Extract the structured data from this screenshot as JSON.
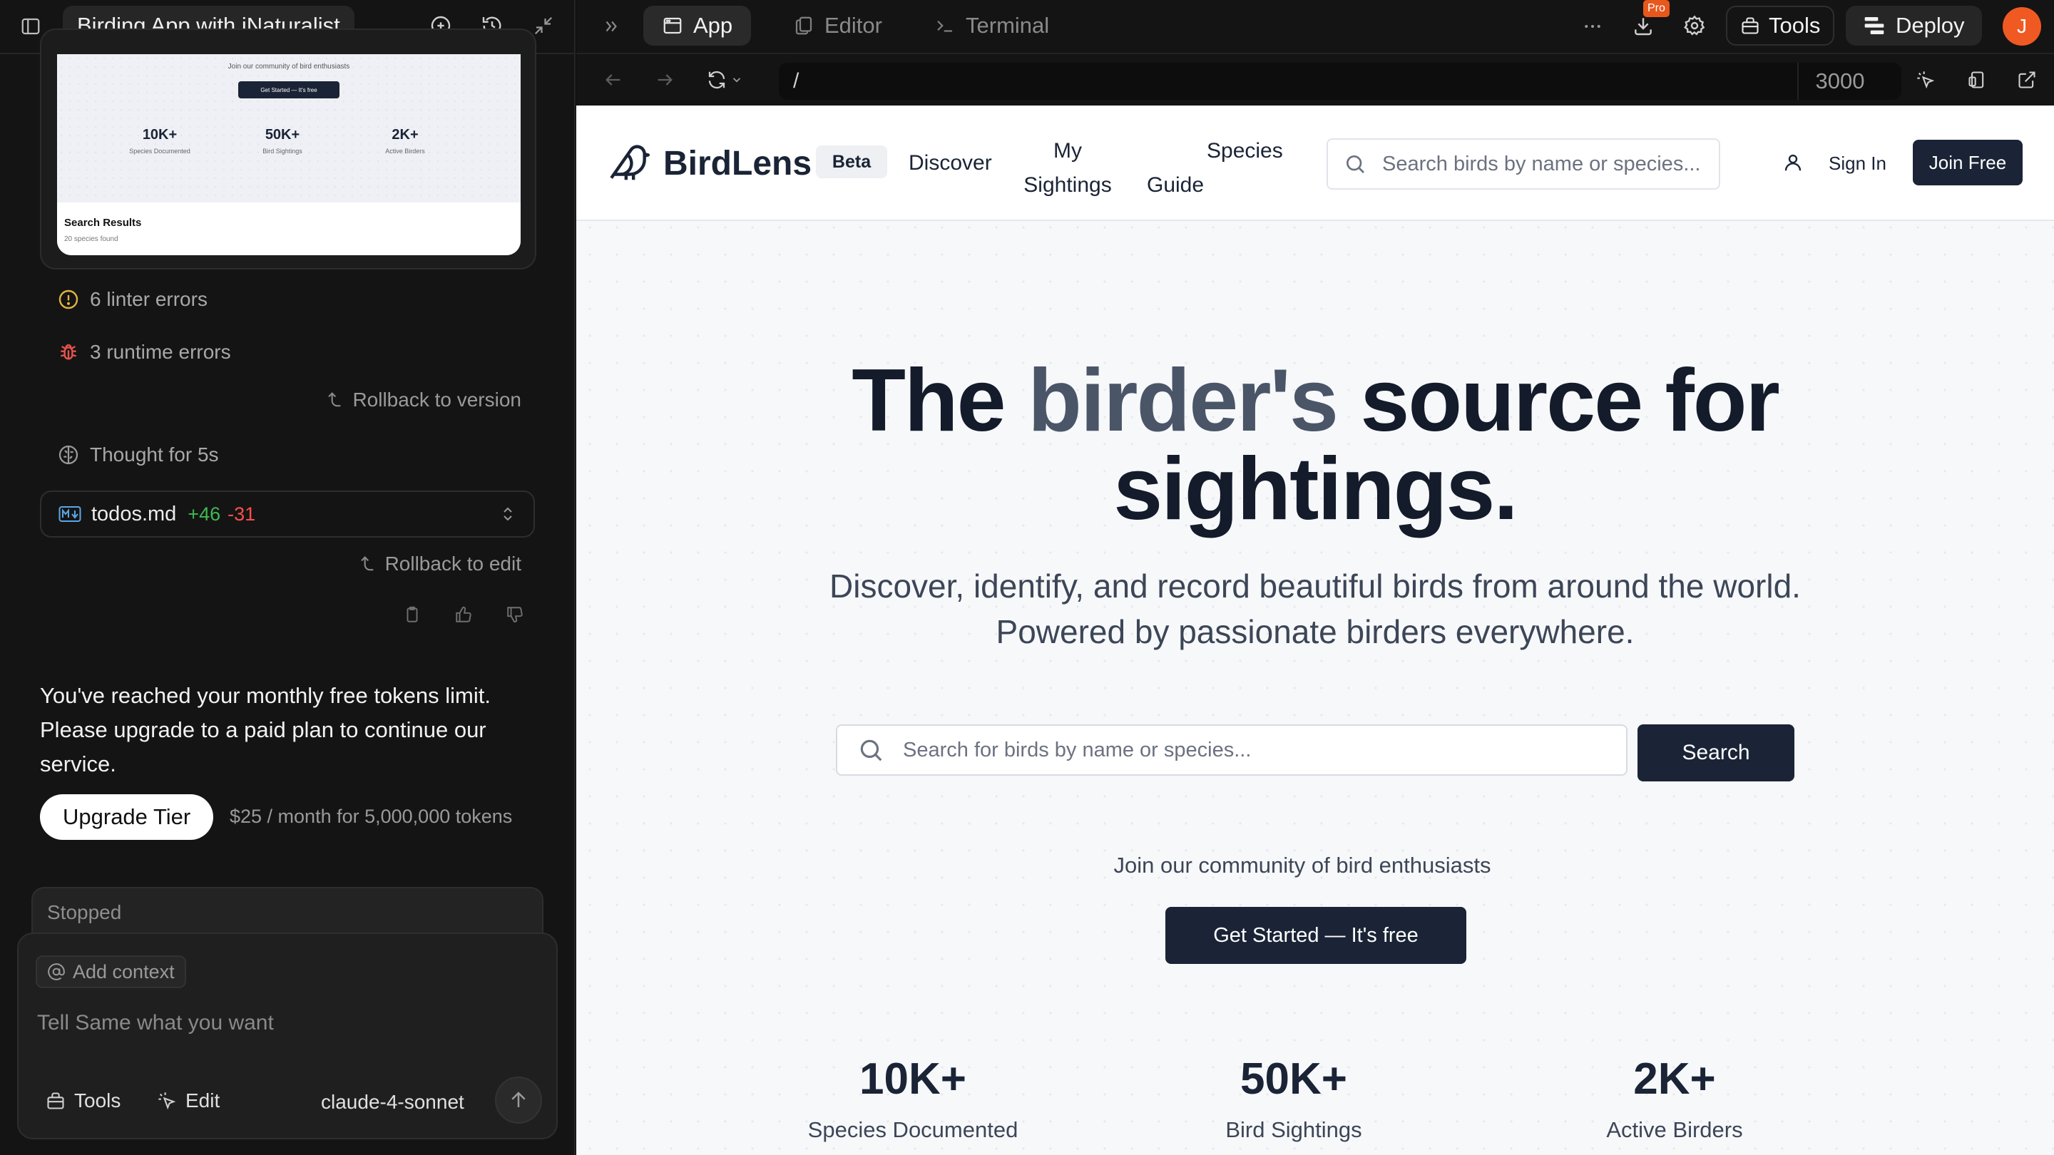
{
  "project": {
    "title": "Birding App with iNaturalist"
  },
  "topbar": {
    "tabs": [
      {
        "label": "App",
        "active": true
      },
      {
        "label": "Editor",
        "active": false
      },
      {
        "label": "Terminal",
        "active": false
      }
    ],
    "pro_badge": "Pro",
    "tools_label": "Tools",
    "deploy_label": "Deploy",
    "avatar_initial": "J"
  },
  "address": {
    "path": "/",
    "port": "3000"
  },
  "thumbnail": {
    "community_text": "Join our community of bird enthusiasts",
    "cta": "Get Started — It's free",
    "stats": [
      {
        "value": "10K+",
        "label": "Species Documented"
      },
      {
        "value": "50K+",
        "label": "Bird Sightings"
      },
      {
        "value": "2K+",
        "label": "Active Birders"
      }
    ],
    "results_title": "Search Results",
    "results_sub": "20 species found"
  },
  "chat": {
    "linter": "6 linter errors",
    "runtime": "3 runtime errors",
    "rollback_version": "Rollback to version",
    "thought": "Thought for 5s",
    "file": {
      "name": "todos.md",
      "added": "+46",
      "removed": "-31"
    },
    "rollback_edit": "Rollback to edit",
    "limit_message": "You've reached your monthly free tokens limit. Please upgrade to a paid plan to continue our service.",
    "upgrade_label": "Upgrade Tier",
    "price_text": "$25 / month for 5,000,000 tokens",
    "stopped": "Stopped",
    "add_context": "Add context",
    "input_placeholder": "Tell Same what you want",
    "tools_label": "Tools",
    "edit_label": "Edit",
    "model": "claude-4-sonnet"
  },
  "site": {
    "brand": "BirdLens",
    "badge": "Beta",
    "nav": [
      "Discover",
      "My Sightings",
      "Species Guide"
    ],
    "nav_lines": [
      [
        "Discover"
      ],
      [
        "My",
        "Sightings"
      ],
      [
        "Species",
        "Guide"
      ]
    ],
    "search_placeholder": "Search birds by name or species...",
    "sign_in": "Sign In",
    "join": "Join Free",
    "hero_part1": "The ",
    "hero_highlight": "birder's",
    "hero_part2": " source for sightings.",
    "subtitle_line1": "Discover, identify, and record beautiful birds from around the world.",
    "subtitle_line2": "Powered by passionate birders everywhere.",
    "main_search_placeholder": "Search for birds by name or species...",
    "search_button": "Search",
    "community": "Join our community of bird enthusiasts",
    "cta": "Get Started — It's free",
    "stats": [
      {
        "value": "10K+",
        "label": "Species Documented"
      },
      {
        "value": "50K+",
        "label": "Bird Sightings"
      },
      {
        "value": "2K+",
        "label": "Active Birders"
      }
    ]
  },
  "colors": {
    "accent_orange": "#f05a22",
    "navy": "#1a2436",
    "hero_highlight": "#4a5568",
    "added_green": "#3fb950",
    "removed_red": "#f85149",
    "warning_yellow": "#e3b341"
  }
}
